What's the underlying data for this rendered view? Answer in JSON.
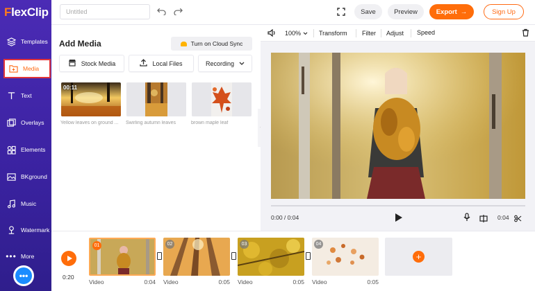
{
  "app": {
    "logo_text": "FlexClip",
    "logo_accent": "F",
    "logo_rest": "lexClip"
  },
  "colors": {
    "brand_purple": "#4b2bb5",
    "accent_orange": "#ff6d0a",
    "active_border": "#e0343a"
  },
  "sidebar": {
    "items": [
      {
        "label": "Templates",
        "icon": "layers-icon"
      },
      {
        "label": "Media",
        "icon": "media-folder-icon",
        "active": true
      },
      {
        "label": "Text",
        "icon": "text-icon"
      },
      {
        "label": "Overlays",
        "icon": "overlays-icon"
      },
      {
        "label": "Elements",
        "icon": "elements-icon"
      },
      {
        "label": "BKground",
        "icon": "background-icon"
      },
      {
        "label": "Music",
        "icon": "music-icon"
      },
      {
        "label": "Watermark",
        "icon": "watermark-icon"
      },
      {
        "label": "More",
        "icon": "more-dots-icon"
      }
    ]
  },
  "topbar": {
    "title_placeholder": "Untitled",
    "save_label": "Save",
    "preview_label": "Preview",
    "export_label": "Export",
    "export_arrow": "→",
    "signup_label": "Sign Up"
  },
  "media_panel": {
    "title": "Add Media",
    "cloud_sync_label": "Turn on Cloud Sync",
    "sources": [
      {
        "label": "Stock Media"
      },
      {
        "label": "Local Files"
      },
      {
        "label": "Recording"
      }
    ],
    "items": [
      {
        "label": "Yellow leaves on ground ...",
        "badge": "00:11"
      },
      {
        "label": "Swirling autumn leaves",
        "badge": ""
      },
      {
        "label": "brown maple leaf",
        "badge": ""
      }
    ]
  },
  "preview": {
    "toolbar": {
      "zoom": "100%",
      "transform_label": "Transform",
      "filter_label": "Filter",
      "adjust_label": "Adjust",
      "speed_label": "Speed"
    },
    "current_time": "0:00 / 0:04",
    "clip_time": "0:04",
    "progress": 0
  },
  "timeline": {
    "total_time": "0:20",
    "clips": [
      {
        "num": "01",
        "label": "Video",
        "duration": "0:04",
        "selected": true
      },
      {
        "num": "02",
        "label": "Video",
        "duration": "0:05",
        "selected": false
      },
      {
        "num": "03",
        "label": "Video",
        "duration": "0:05",
        "selected": false
      },
      {
        "num": "04",
        "label": "Video",
        "duration": "0:05",
        "selected": false
      }
    ],
    "add_label": "+"
  }
}
